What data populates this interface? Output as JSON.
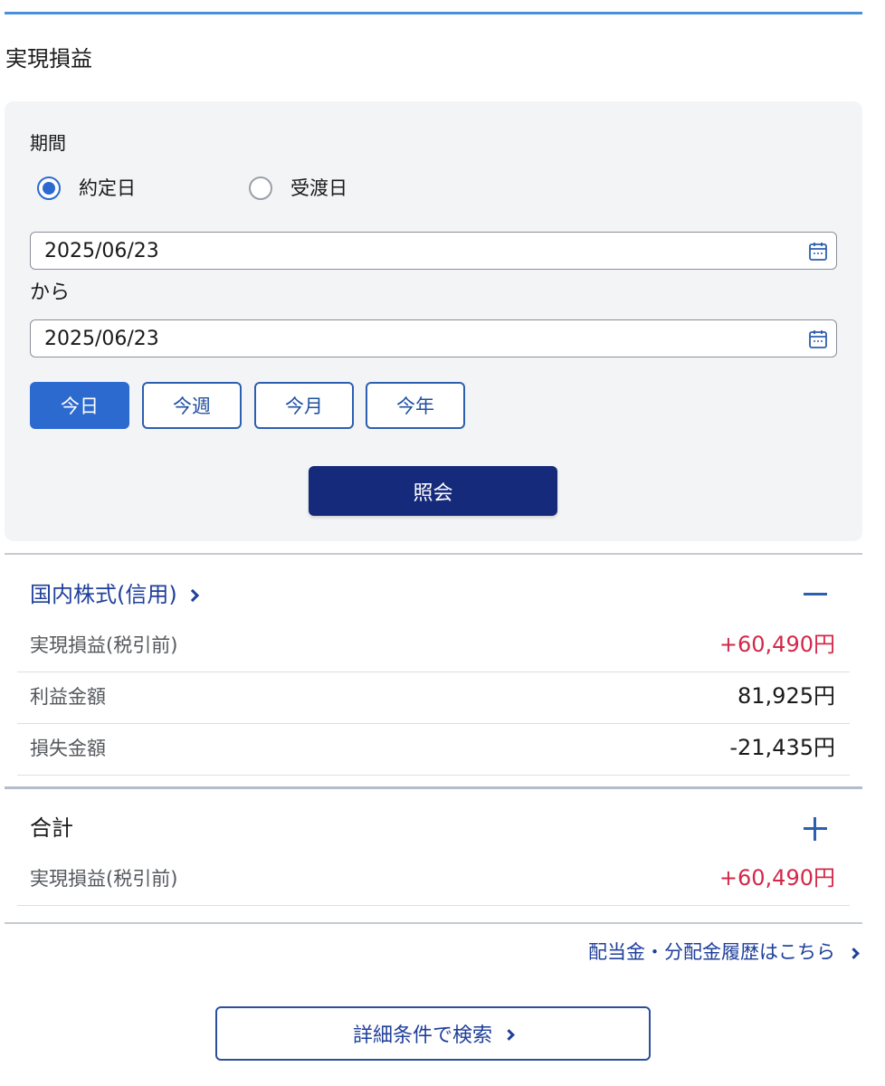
{
  "page": {
    "title": "実現損益"
  },
  "period": {
    "label": "期間",
    "radios": [
      {
        "label": "約定日",
        "checked": true
      },
      {
        "label": "受渡日",
        "checked": false
      }
    ],
    "start_date": "2025/06/23",
    "from_label": "から",
    "end_date": "2025/06/23",
    "quick_buttons": [
      {
        "label": "今日",
        "active": true
      },
      {
        "label": "今週",
        "active": false
      },
      {
        "label": "今月",
        "active": false
      },
      {
        "label": "今年",
        "active": false
      }
    ],
    "submit_label": "照会"
  },
  "domestic_margin": {
    "title": "国内株式(信用)",
    "toggle_icon": "minus-icon",
    "rows": [
      {
        "label": "実現損益(税引前)",
        "value": "+60,490円"
      },
      {
        "label": "利益金額",
        "value": "81,925円"
      },
      {
        "label": "損失金額",
        "value": "-21,435円"
      }
    ]
  },
  "total": {
    "title": "合計",
    "toggle_icon": "plus-icon",
    "rows": [
      {
        "label": "実現損益(税引前)",
        "value": "+60,490円"
      }
    ]
  },
  "links": {
    "dividend_history": "配当金・分配金履歴はこちら",
    "detail_search": "詳細条件で検索"
  },
  "colors": {
    "primary": "#2d6ad0",
    "navy": "#162a7c",
    "positive": "#d3284a",
    "accent_rule": "#4a90d9"
  }
}
